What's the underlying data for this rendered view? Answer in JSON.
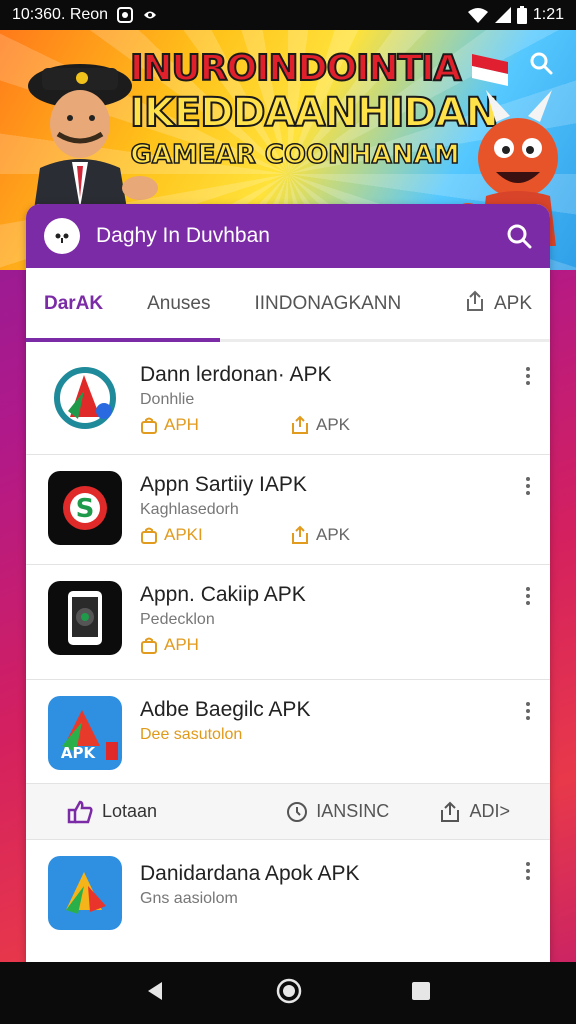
{
  "status_bar": {
    "time_left": "10:360. Reon",
    "time_right": "1:21",
    "icons": [
      "whatsapp-icon",
      "cast-icon",
      "wifi-icon",
      "signal-icon",
      "battery-icon"
    ]
  },
  "banner": {
    "line1": "INUROINDOINTIA",
    "line2": "IKEDDAANHIDAN",
    "line3": "GAMEAR COONHANAM"
  },
  "header": {
    "title": "Daghy In Duvhban"
  },
  "tabs": [
    {
      "label": "DarAK",
      "active": true
    },
    {
      "label": "Anuses",
      "active": false
    },
    {
      "label": "IINDONAGKANN",
      "active": false
    }
  ],
  "tab_apk_label": "APK",
  "apps": [
    {
      "title": "Dann lerdonan· APK",
      "subtitle": "Donhlie",
      "action1": "APH",
      "action2": "APK"
    },
    {
      "title": "Appn Sartiiy IAPK",
      "subtitle": "Kaghlasedorh",
      "action1": "APKI",
      "action2": "APK"
    },
    {
      "title": "Appn. Cakiip APK",
      "subtitle": "Pedecklon",
      "action1": "APH"
    },
    {
      "title": "Adbe Baegilc APK",
      "subtitle": "Dee sasutolon"
    },
    {
      "title": "Danidardana Apok APK",
      "subtitle": "Gns aasiolom"
    }
  ],
  "bottom_strip": {
    "item1": "Lotaan",
    "item2": "IANSINC",
    "item3": "ADI>"
  },
  "colors": {
    "header_purple": "#7c2ba6",
    "action_orange": "#e19b1e"
  }
}
